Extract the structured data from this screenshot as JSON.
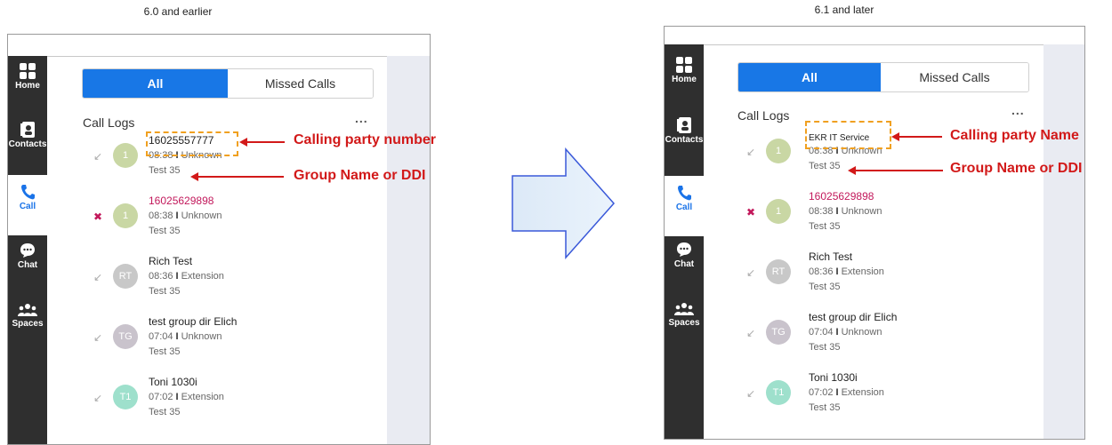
{
  "captions": {
    "left": "6.0 and earlier",
    "right": "6.1 and later"
  },
  "sidebar_items": [
    {
      "label": "Home",
      "icon": "home-grid-icon"
    },
    {
      "label": "Contacts",
      "icon": "contacts-card-icon"
    },
    {
      "label": "Call",
      "icon": "phone-icon"
    },
    {
      "label": "Chat",
      "icon": "chat-bubble-icon"
    },
    {
      "label": "Spaces",
      "icon": "people-group-icon"
    }
  ],
  "tabs": {
    "all": "All",
    "missed": "Missed Calls"
  },
  "section": {
    "title": "Call Logs",
    "more": "..."
  },
  "colors": {
    "accent": "#1877e6",
    "annotation": "#d21919",
    "highlight": "#f0a020",
    "sidebar": "#2f2f2f"
  },
  "left_panel": {
    "entries": [
      {
        "name": "16025557777",
        "time": "08:38",
        "kind": "Unknown",
        "group": "Test 35",
        "avatar": "1",
        "missed": false
      },
      {
        "name": "16025629898",
        "time": "08:38",
        "kind": "Unknown",
        "group": "Test 35",
        "avatar": "1",
        "missed": true
      },
      {
        "name": "Rich Test",
        "time": "08:36",
        "kind": "Extension",
        "group": "Test 35",
        "avatar": "RT",
        "missed": false
      },
      {
        "name": "test group dir Elich",
        "time": "07:04",
        "kind": "Unknown",
        "group": "Test 35",
        "avatar": "TG",
        "missed": false
      },
      {
        "name": "Toni 1030i",
        "time": "07:02",
        "kind": "Extension",
        "group": "Test 35",
        "avatar": "T1",
        "missed": false
      }
    ],
    "annotations": {
      "first": "Calling party number",
      "second": "Group Name or DDI"
    }
  },
  "right_panel": {
    "entries": [
      {
        "name": "EKR IT Service",
        "time": "08:38",
        "kind": "Unknown",
        "group": "Test 35",
        "avatar": "1",
        "missed": false
      },
      {
        "name": "16025629898",
        "time": "08:38",
        "kind": "Unknown",
        "group": "Test 35",
        "avatar": "1",
        "missed": true
      },
      {
        "name": "Rich Test",
        "time": "08:36",
        "kind": "Extension",
        "group": "Test 35",
        "avatar": "RT",
        "missed": false
      },
      {
        "name": "test group dir Elich",
        "time": "07:04",
        "kind": "Unknown",
        "group": "Test 35",
        "avatar": "TG",
        "missed": false
      },
      {
        "name": "Toni 1030i",
        "time": "07:02",
        "kind": "Extension",
        "group": "Test 35",
        "avatar": "T1",
        "missed": false
      }
    ],
    "annotations": {
      "first": "Calling party Name",
      "second": "Group Name or DDI"
    }
  }
}
